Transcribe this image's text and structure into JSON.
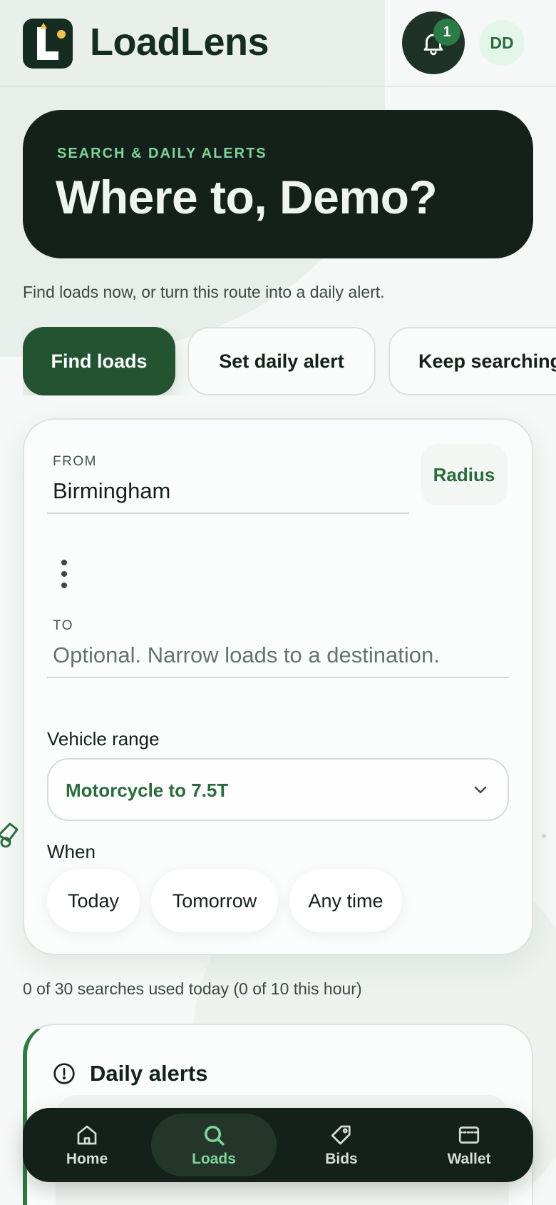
{
  "app": {
    "name": "LoadLens"
  },
  "header": {
    "notification_count": "1",
    "avatar_initials": "DD"
  },
  "hero": {
    "eyebrow": "SEARCH & DAILY ALERTS",
    "title": "Where to, Demo?"
  },
  "subtitle": "Find loads now, or turn this route into a daily alert.",
  "actions": [
    {
      "label": "Find loads",
      "active": true
    },
    {
      "label": "Set daily alert",
      "active": false
    },
    {
      "label": "Keep searching",
      "active": false
    }
  ],
  "form": {
    "from_label": "FROM",
    "from_value": "Birmingham",
    "radius_label": "Radius",
    "to_label": "TO",
    "to_placeholder": "Optional. Narrow loads to a destination.",
    "to_value": "",
    "vehicle_label": "Vehicle range",
    "vehicle_value": "Motorcycle to 7.5T",
    "when_label": "When",
    "when_options": [
      "Today",
      "Tomorrow",
      "Any time"
    ]
  },
  "usage_text": "0 of 30 searches used today (0 of 10 this hour)",
  "alerts": {
    "title": "Daily alerts"
  },
  "nav": [
    {
      "label": "Home",
      "icon": "home-icon",
      "active": false
    },
    {
      "label": "Loads",
      "icon": "search-icon",
      "active": true
    },
    {
      "label": "Bids",
      "icon": "tag-icon",
      "active": false
    },
    {
      "label": "Wallet",
      "icon": "wallet-icon",
      "active": false
    }
  ],
  "colors": {
    "brand_dark": "#14201a",
    "accent_green": "#235331",
    "accent_light": "#7fd49a",
    "badge_green": "#2c7a45"
  }
}
